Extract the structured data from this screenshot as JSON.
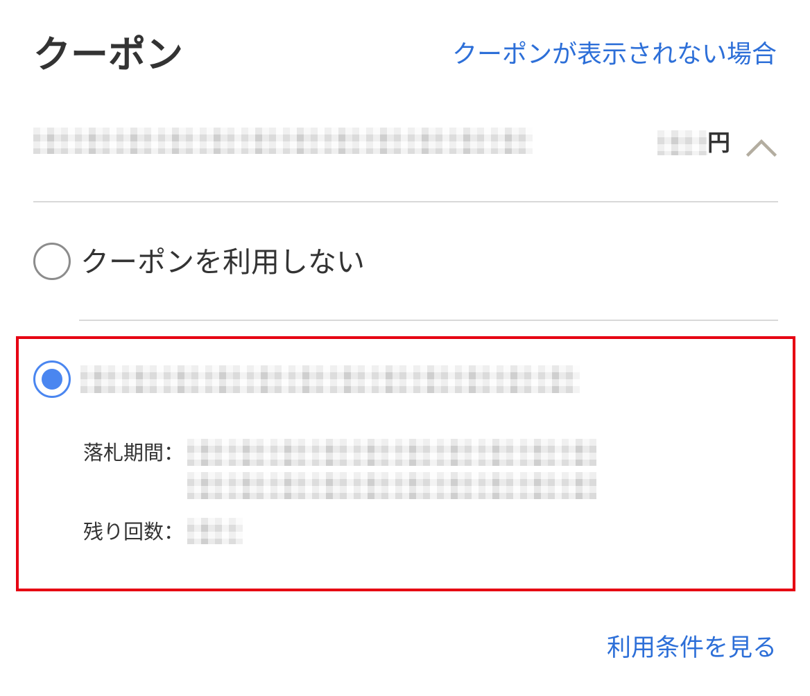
{
  "header": {
    "title": "クーポン",
    "help_link": "クーポンが表示されない場合"
  },
  "selected_coupon": {
    "currency_unit": "円",
    "expanded": true
  },
  "options": [
    {
      "label": "クーポンを利用しない",
      "selected": false
    },
    {
      "selected": true,
      "details": [
        {
          "label": "落札期間："
        },
        {
          "label": "残り回数："
        }
      ]
    }
  ],
  "footer": {
    "terms_link": "利用条件を見る"
  },
  "icons": {
    "toggle": "chevron-up-icon",
    "radio_off": "radio-unchecked-icon",
    "radio_on": "radio-checked-icon"
  },
  "colors": {
    "link": "#2d6fd8",
    "radio_selected": "#4a86f0",
    "radio_unselected": "#8c8c8c",
    "highlight": "#e60012",
    "text": "#333333",
    "chevron": "#b3ada0",
    "divider": "#d8d8d8"
  }
}
